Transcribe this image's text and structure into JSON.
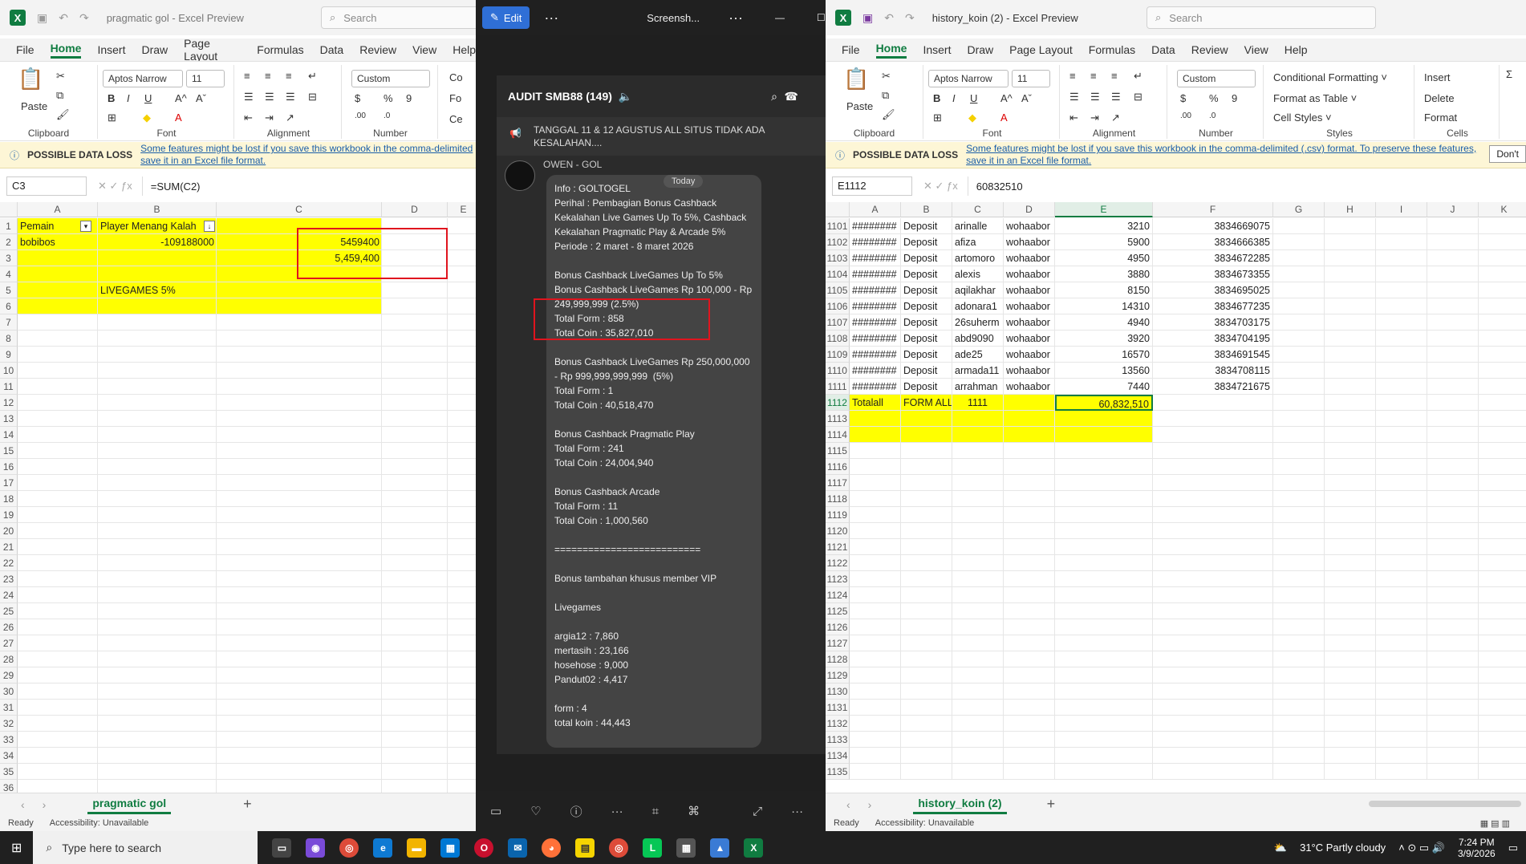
{
  "left_excel": {
    "title": "pragmatic gol  -  Excel Preview",
    "search_placeholder": "Search",
    "menus": [
      "File",
      "Home",
      "Insert",
      "Draw",
      "Page Layout",
      "Formulas",
      "Data",
      "Review",
      "View",
      "Help"
    ],
    "ribbon": {
      "paste": "Paste",
      "clipboard": "Clipboard",
      "font_name": "Aptos Narrow",
      "font_size": "11",
      "font": "Font",
      "alignment": "Alignment",
      "number_format": "Custom",
      "number": "Number",
      "co": "Co",
      "fo": "Fo",
      "ce": "Ce"
    },
    "warning_label": "POSSIBLE DATA LOSS",
    "warning_msg": "Some features might be lost if you save this workbook in the comma-delimited\nsave it in an Excel file format.",
    "name_box": "C3",
    "formula": "=SUM(C2)",
    "columns": [
      "A",
      "B",
      "C",
      "D",
      "E"
    ],
    "rows": [
      "1",
      "2",
      "3",
      "4",
      "5",
      "6",
      "7",
      "8",
      "9",
      "10",
      "11",
      "12",
      "13",
      "14",
      "15",
      "16",
      "17",
      "18",
      "19",
      "20",
      "21",
      "22",
      "23",
      "24",
      "25",
      "26",
      "27",
      "28",
      "29",
      "30",
      "31",
      "32",
      "33",
      "34",
      "35",
      "36"
    ],
    "cells": {
      "a1": "Pemain",
      "b1": "Player Menang Kalah",
      "a2": "bobibos",
      "b2": "-109188000",
      "c2": "5459400",
      "c3": "5,459,400",
      "b5": "LIVEGAMES 5%"
    },
    "sheet_tab": "pragmatic gol",
    "status": "Ready",
    "accessibility": "Accessibility: Unavailable"
  },
  "phone": {
    "edit": "Edit",
    "title": "Screensh...",
    "chat_title": "AUDIT SMB88 (149)",
    "pinned": "TANGGAL 11 & 12 AGUSTUS ALL SITUS TIDAK ADA KESALAHAN....",
    "sender": "OWEN - GOL",
    "today": "Today",
    "message": "Info : GOLTOGEL\nPerihal : Pembagian Bonus Cashback Kekalahan Live Games Up To 5%, Cashback Kekalahan Pragmatic Play & Arcade 5%\nPeriode : 2 maret - 8 maret 2026\n\nBonus Cashback LiveGames Up To 5%\nBonus Cashback LiveGames Rp 100,000 - Rp 249,999,999 (2.5%)\nTotal Form : 858\nTotal Coin : 35,827,010\n\nBonus Cashback LiveGames Rp 250,000,000 - Rp 999,999,999,999  (5%)\nTotal Form : 1\nTotal Coin : 40,518,470\n\nBonus Cashback Pragmatic Play\nTotal Form : 241\nTotal Coin : 24,004,940\n\nBonus Cashback Arcade\nTotal Form : 11\nTotal Coin : 1,000,560\n\n==========================\n\nBonus tambahan khusus member VIP\n\nLivegames\n\nargia12 : 7,860\nmertasih : 23,166\nhosehose : 9,000\nPandut02 : 4,417\n\nform : 4\ntotal koin : 44,443"
  },
  "right_excel": {
    "title": "history_koin (2)  -  Excel Preview",
    "search_placeholder": "Search",
    "menus": [
      "File",
      "Home",
      "Insert",
      "Draw",
      "Page Layout",
      "Formulas",
      "Data",
      "Review",
      "View",
      "Help"
    ],
    "ribbon": {
      "paste": "Paste",
      "clipboard": "Clipboard",
      "font_name": "Aptos Narrow",
      "font_size": "11",
      "font": "Font",
      "alignment": "Alignment",
      "number_format": "Custom",
      "number": "Number",
      "cond": "Conditional Formatting",
      "fmt_table": "Format as Table",
      "cell_styles": "Cell Styles",
      "styles": "Styles",
      "insert": "Insert",
      "delete": "Delete",
      "format": "Format",
      "cells": "Cells"
    },
    "warning_label": "POSSIBLE DATA LOSS",
    "warning_msg": "Some features might be lost if you save this workbook in the comma-delimited (.csv) format. To preserve these features,\nsave it in an Excel file format.",
    "dont": "Don't",
    "name_box": "E1112",
    "formula": "60832510",
    "columns": [
      "A",
      "B",
      "C",
      "D",
      "E",
      "F",
      "G",
      "H",
      "I",
      "J",
      "K"
    ],
    "data_rows": [
      [
        "1101",
        "########",
        "Deposit",
        "arinalle",
        "wohaabor",
        "3210",
        "3834669075"
      ],
      [
        "1102",
        "########",
        "Deposit",
        "afiza",
        "wohaabor",
        "5900",
        "3834666385"
      ],
      [
        "1103",
        "########",
        "Deposit",
        "artomoro",
        "wohaabor",
        "4950",
        "3834672285"
      ],
      [
        "1104",
        "########",
        "Deposit",
        "alexis",
        "wohaabor",
        "3880",
        "3834673355"
      ],
      [
        "1105",
        "########",
        "Deposit",
        "aqilakhar",
        "wohaabor",
        "8150",
        "3834695025"
      ],
      [
        "1106",
        "########",
        "Deposit",
        "adonara1",
        "wohaabor",
        "14310",
        "3834677235"
      ],
      [
        "1107",
        "########",
        "Deposit",
        "26suherm",
        "wohaabor",
        "4940",
        "3834703175"
      ],
      [
        "1108",
        "########",
        "Deposit",
        "abd9090",
        "wohaabor",
        "3920",
        "3834704195"
      ],
      [
        "1109",
        "########",
        "Deposit",
        "ade25",
        "wohaabor",
        "16570",
        "3834691545"
      ],
      [
        "1110",
        "########",
        "Deposit",
        "armada11",
        "wohaabor",
        "13560",
        "3834708115"
      ],
      [
        "1111",
        "########",
        "Deposit",
        "arrahman",
        "wohaabor",
        "7440",
        "3834721675"
      ]
    ],
    "total_row": {
      "row": "1112",
      "a": "Totalall",
      "b": "FORM ALL",
      "c": "1111",
      "e": "60,832,510"
    },
    "empty_rows": [
      "1113",
      "1114",
      "1115",
      "1116",
      "1117",
      "1118",
      "1119",
      "1120",
      "1121",
      "1122",
      "1123",
      "1124",
      "1125",
      "1126",
      "1127",
      "1128",
      "1129",
      "1130",
      "1131",
      "1132",
      "1133",
      "1134",
      "1135"
    ],
    "sheet_tab": "history_koin (2)",
    "status": "Ready",
    "accessibility": "Accessibility: Unavailable"
  },
  "taskbar": {
    "search": "Type here to search",
    "weather": "31°C  Partly cloudy",
    "time": "7:24 PM",
    "date": "3/9/2026"
  }
}
